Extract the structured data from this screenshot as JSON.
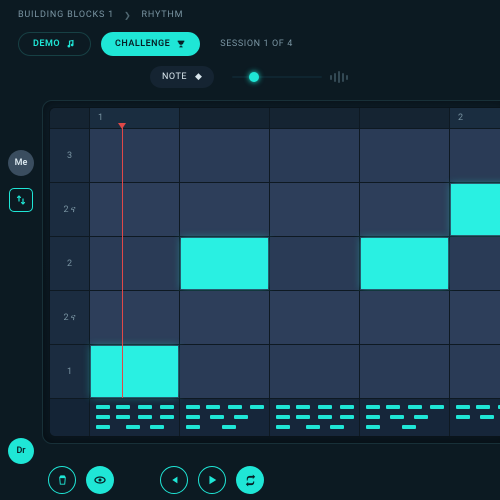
{
  "breadcrumb": {
    "item1": "BUILDING BLOCKS 1",
    "item2": "RHYTHM"
  },
  "mode": {
    "demo_label": "DEMO",
    "challenge_label": "CHALLENGE",
    "session_label": "SESSION 1 OF 4"
  },
  "tool": {
    "note_label": "NOTE"
  },
  "rail": {
    "me": "Me",
    "dr": "Dr"
  },
  "colors": {
    "cyan": "#1fe6d6",
    "red": "#e04848"
  },
  "grid": {
    "beat_headers": [
      "1",
      "",
      "",
      "",
      "2"
    ],
    "rows": [
      "3",
      "2 ና",
      "2",
      "2 ና",
      "1"
    ],
    "playhead_beat_fraction": 0.35,
    "notes": [
      {
        "row": 1,
        "col": 4
      },
      {
        "row": 2,
        "col": 1
      },
      {
        "row": 2,
        "col": 3
      },
      {
        "row": 4,
        "col": 0
      }
    ],
    "drum_ticks": [
      [
        {
          "x": 6,
          "y": 6
        },
        {
          "x": 26,
          "y": 6
        },
        {
          "x": 48,
          "y": 6
        },
        {
          "x": 70,
          "y": 6
        },
        {
          "x": 6,
          "y": 16
        },
        {
          "x": 26,
          "y": 16
        },
        {
          "x": 48,
          "y": 16
        },
        {
          "x": 70,
          "y": 16
        },
        {
          "x": 6,
          "y": 26
        },
        {
          "x": 36,
          "y": 26
        },
        {
          "x": 60,
          "y": 26
        }
      ],
      [
        {
          "x": 6,
          "y": 6
        },
        {
          "x": 26,
          "y": 6
        },
        {
          "x": 48,
          "y": 6
        },
        {
          "x": 70,
          "y": 6
        },
        {
          "x": 6,
          "y": 16
        },
        {
          "x": 30,
          "y": 16
        },
        {
          "x": 54,
          "y": 16
        },
        {
          "x": 6,
          "y": 26
        },
        {
          "x": 42,
          "y": 26
        }
      ],
      [
        {
          "x": 6,
          "y": 6
        },
        {
          "x": 26,
          "y": 6
        },
        {
          "x": 48,
          "y": 6
        },
        {
          "x": 70,
          "y": 6
        },
        {
          "x": 6,
          "y": 16
        },
        {
          "x": 26,
          "y": 16
        },
        {
          "x": 48,
          "y": 16
        },
        {
          "x": 70,
          "y": 16
        },
        {
          "x": 6,
          "y": 26
        },
        {
          "x": 36,
          "y": 26
        },
        {
          "x": 60,
          "y": 26
        }
      ],
      [
        {
          "x": 6,
          "y": 6
        },
        {
          "x": 26,
          "y": 6
        },
        {
          "x": 48,
          "y": 6
        },
        {
          "x": 70,
          "y": 6
        },
        {
          "x": 6,
          "y": 16
        },
        {
          "x": 30,
          "y": 16
        },
        {
          "x": 54,
          "y": 16
        },
        {
          "x": 6,
          "y": 26
        },
        {
          "x": 42,
          "y": 26
        }
      ],
      [
        {
          "x": 6,
          "y": 6
        },
        {
          "x": 26,
          "y": 6
        },
        {
          "x": 48,
          "y": 6
        },
        {
          "x": 6,
          "y": 16
        },
        {
          "x": 30,
          "y": 16
        }
      ]
    ]
  }
}
